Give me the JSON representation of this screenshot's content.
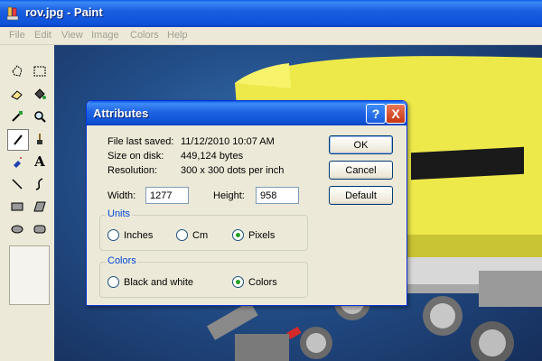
{
  "window": {
    "title": "rov.jpg - Paint"
  },
  "menu": [
    "File",
    "Edit",
    "View",
    "Image",
    "Colors",
    "Help"
  ],
  "dialog": {
    "title": "Attributes",
    "help_button": "?",
    "close_button": "X",
    "info": [
      {
        "label": "File last saved:",
        "value": "11/12/2010 10:07 AM"
      },
      {
        "label": "Size on disk:",
        "value": "449,124 bytes"
      },
      {
        "label": "Resolution:",
        "value": "300 x 300 dots per inch"
      }
    ],
    "width": {
      "label": "Width:",
      "value": "1277"
    },
    "height": {
      "label": "Height:",
      "value": "958"
    },
    "units": {
      "title": "Units",
      "options": [
        "Inches",
        "Cm",
        "Pixels"
      ],
      "selected": "Pixels"
    },
    "colors": {
      "title": "Colors",
      "options": [
        "Black and white",
        "Colors"
      ],
      "selected": "Colors"
    },
    "buttons": {
      "ok": "OK",
      "cancel": "Cancel",
      "default": "Default"
    }
  },
  "tools": [
    "free-form-select-icon",
    "select-icon",
    "eraser-icon",
    "fill-icon",
    "pick-color-icon",
    "magnifier-icon",
    "pencil-icon",
    "brush-icon",
    "airbrush-icon",
    "text-icon",
    "line-icon",
    "curve-icon",
    "rectangle-icon",
    "polygon-icon",
    "ellipse-icon",
    "rounded-rectangle-icon"
  ],
  "selected_tool": "pencil-icon",
  "colors": {
    "titlebar": "#0a58e8",
    "dialog_bg": "#ece9d8",
    "group_title": "#0046d5",
    "radio_dot": "#21a121"
  }
}
